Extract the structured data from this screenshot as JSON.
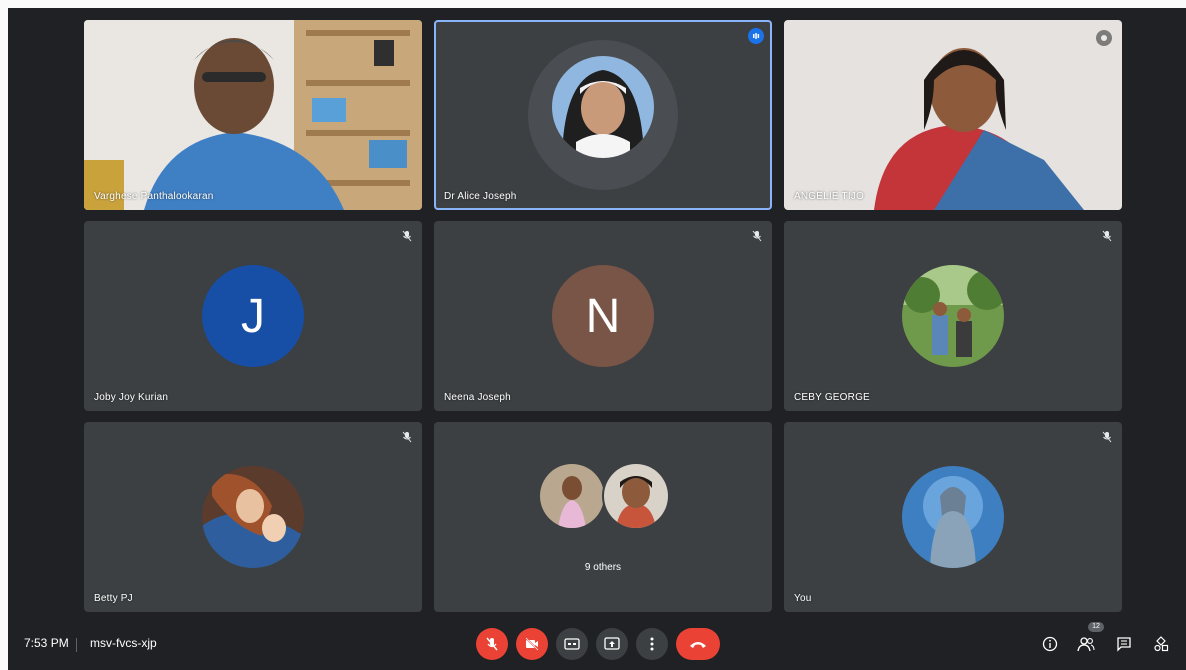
{
  "meeting": {
    "time": "7:53 PM",
    "separator": "|",
    "code": "msv-fvcs-xjp"
  },
  "tiles": [
    {
      "name": "Varghese Panthalookaran"
    },
    {
      "name": "Dr Alice Joseph"
    },
    {
      "name": "ANGELIE TIJO"
    },
    {
      "name": "Joby Joy Kurian",
      "initial": "J",
      "color": "#174ea6"
    },
    {
      "name": "Neena Joseph",
      "initial": "N",
      "color": "#795548"
    },
    {
      "name": "CEBY GEORGE"
    },
    {
      "name": "Betty PJ"
    },
    {
      "name": "9 others"
    },
    {
      "name": "You"
    }
  ],
  "participants_count": "12",
  "colors": {
    "background": "#202124",
    "tile": "#3c4043",
    "active_border": "#8ab4f8",
    "danger": "#ea4335"
  },
  "icons": [
    "mic-off-icon",
    "camera-off-icon",
    "captions-icon",
    "present-icon",
    "more-icon",
    "hang-up-icon",
    "info-icon",
    "people-icon",
    "chat-icon",
    "activities-icon"
  ]
}
